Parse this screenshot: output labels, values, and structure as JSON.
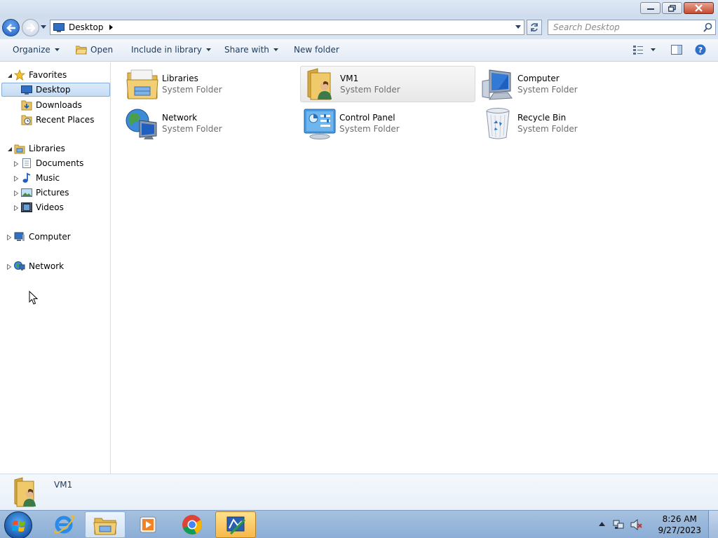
{
  "window": {
    "controls": {
      "minimize": "minimize",
      "restore": "restore",
      "close": "close"
    }
  },
  "address": {
    "breadcrumb": [
      "Desktop"
    ],
    "search_placeholder": "Search Desktop"
  },
  "toolbar": {
    "organize": "Organize",
    "open": "Open",
    "include_in_library": "Include in library",
    "share_with": "Share with",
    "new_folder": "New folder"
  },
  "navpane": {
    "favorites": {
      "label": "Favorites",
      "items": [
        {
          "label": "Desktop",
          "icon": "desktop-icon",
          "selected": true
        },
        {
          "label": "Downloads",
          "icon": "downloads-icon"
        },
        {
          "label": "Recent Places",
          "icon": "recent-places-icon"
        }
      ]
    },
    "libraries": {
      "label": "Libraries",
      "items": [
        {
          "label": "Documents",
          "icon": "documents-icon"
        },
        {
          "label": "Music",
          "icon": "music-icon"
        },
        {
          "label": "Pictures",
          "icon": "pictures-icon"
        },
        {
          "label": "Videos",
          "icon": "videos-icon"
        }
      ]
    },
    "computer": {
      "label": "Computer"
    },
    "network": {
      "label": "Network"
    }
  },
  "content": {
    "items": [
      {
        "name": "Libraries",
        "type": "System Folder",
        "icon": "libraries-icon"
      },
      {
        "name": "VM1",
        "type": "System Folder",
        "icon": "user-folder-icon",
        "selected": true
      },
      {
        "name": "Computer",
        "type": "System Folder",
        "icon": "computer-icon"
      },
      {
        "name": "Network",
        "type": "System Folder",
        "icon": "network-icon"
      },
      {
        "name": "Control Panel",
        "type": "System Folder",
        "icon": "control-panel-icon"
      },
      {
        "name": "Recycle Bin",
        "type": "System Folder",
        "icon": "recycle-bin-icon"
      }
    ]
  },
  "details": {
    "name": "VM1"
  },
  "taskbar": {
    "apps": [
      "internet-explorer",
      "windows-explorer",
      "media-player",
      "chrome",
      "virtualbox-guest"
    ],
    "clock": {
      "time": "8:26 AM",
      "date": "9/27/2023"
    }
  },
  "colors": {
    "accent": "#1e395b",
    "selection": "#c4dcf5",
    "taskbar": "#8badd6"
  }
}
